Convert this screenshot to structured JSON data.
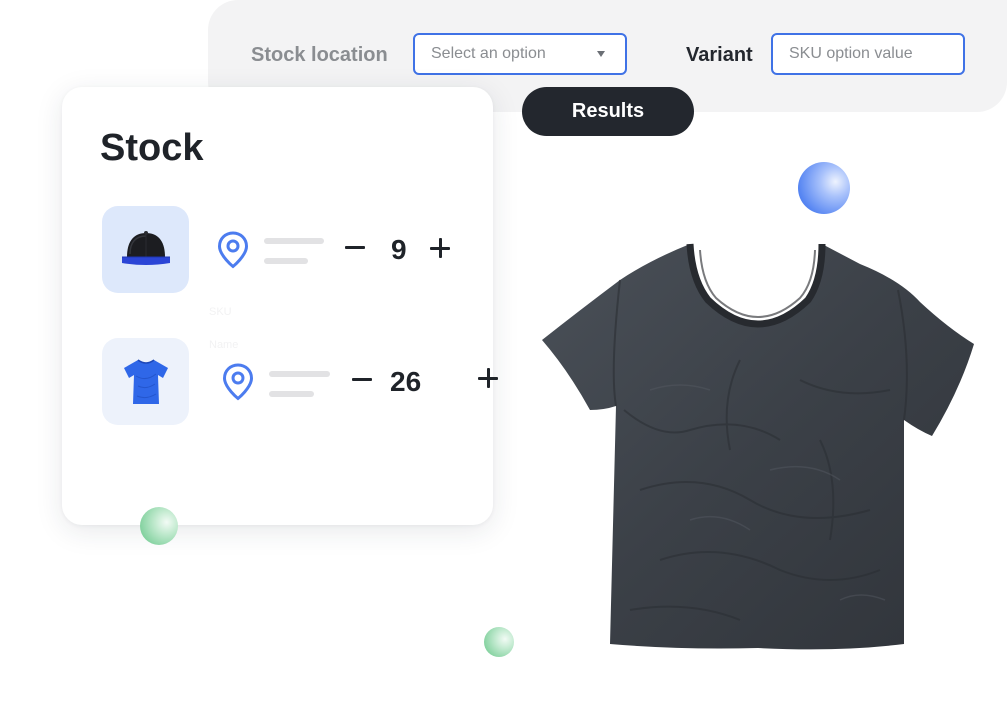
{
  "filters": {
    "stock_location_label": "Stock location",
    "stock_location_select": {
      "selected": "Select an option"
    },
    "variant_label": "Variant",
    "variant_input": {
      "placeholder": "SKU option value"
    },
    "results_button": "Results"
  },
  "stock": {
    "title": "Stock",
    "rows": [
      {
        "thumbnail": "cap-icon",
        "location_icon": "map-pin-icon",
        "quantity": "9"
      },
      {
        "thumbnail": "tshirt-icon",
        "location_icon": "map-pin-icon",
        "quantity": "26"
      }
    ],
    "ghost_labels": [
      "SKU",
      "Name"
    ]
  },
  "colors": {
    "accent_blue": "#3f72e6",
    "dark": "#23272e",
    "muted_text": "#8a8d91",
    "panel_bg": "#f3f3f4"
  }
}
